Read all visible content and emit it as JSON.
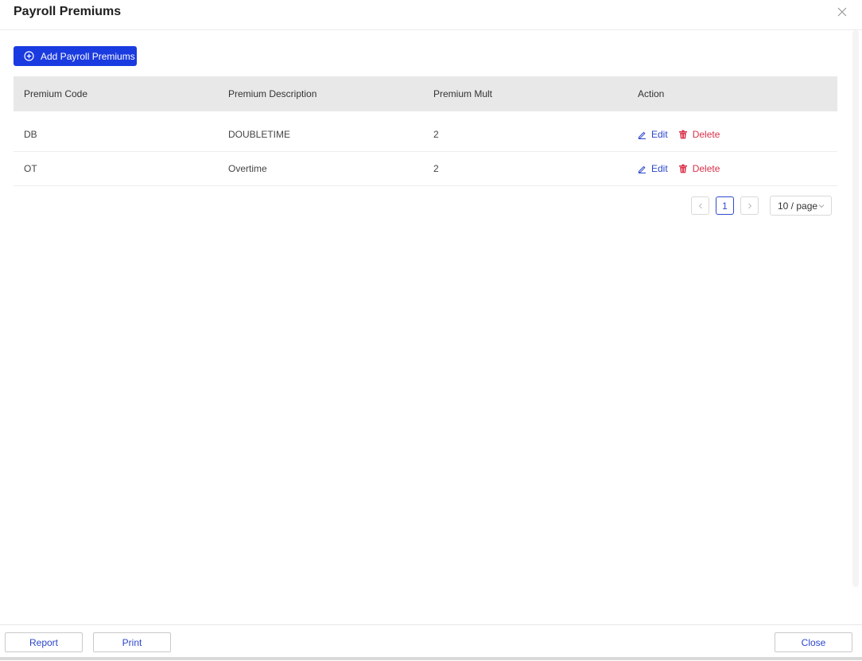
{
  "dialog": {
    "title": "Payroll Premiums",
    "close_label": "×"
  },
  "toolbar": {
    "add_label": "Add Payroll Premiums"
  },
  "table": {
    "headers": [
      "Premium Code",
      "Premium Description",
      "Premium Mult",
      "Action"
    ],
    "rows": [
      {
        "code": "DB",
        "description": "DOUBLETIME",
        "mult": "2",
        "edit": "Edit",
        "delete": "Delete"
      },
      {
        "code": "OT",
        "description": "Overtime",
        "mult": "2",
        "edit": "Edit",
        "delete": "Delete"
      }
    ]
  },
  "pagination": {
    "current_page": "1",
    "page_size": "10 / page"
  },
  "footer": {
    "report_label": "Report",
    "print_label": "Print",
    "close_label": "Close"
  },
  "colors": {
    "primary": "#1a3be0",
    "link": "#2a46c9",
    "danger": "#d9304a",
    "header_bg": "#e8e8e8"
  },
  "icons": {
    "add": "plus-circle-icon",
    "edit": "pencil-icon",
    "delete": "trash-icon",
    "close": "close-icon",
    "prev": "chevron-left-icon",
    "next": "chevron-right-icon",
    "dropdown": "chevron-down-icon"
  }
}
